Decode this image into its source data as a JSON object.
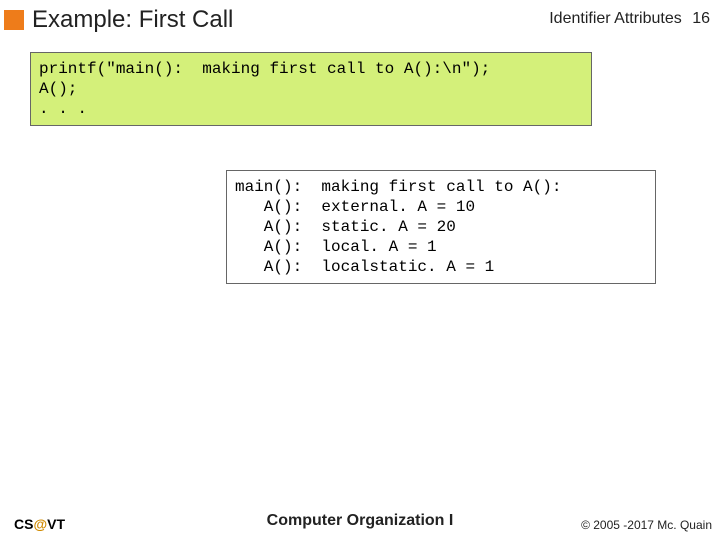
{
  "header": {
    "title": "Example:  First Call",
    "topic": "Identifier Attributes",
    "slide_number": "16"
  },
  "code_box": "printf(\"main():  making first call to A():\\n\");\nA();\n. . .",
  "output_box": "main():  making first call to A():\n   A():  external. A = 10\n   A():  static. A = 20\n   A():  local. A = 1\n   A():  localstatic. A = 1",
  "footer": {
    "left_cs": "CS",
    "left_at": "@",
    "left_vt": "VT",
    "center": "Computer Organization I",
    "right": "© 2005 -2017 Mc. Quain"
  }
}
